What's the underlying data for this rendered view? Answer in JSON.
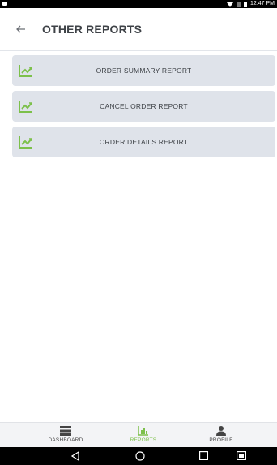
{
  "status_bar": {
    "time": "12:47 PM"
  },
  "app_bar": {
    "title": "OTHER REPORTS",
    "back_icon": "arrow-left-icon"
  },
  "reports": [
    {
      "label": "ORDER SUMMARY REPORT",
      "icon": "trend-chart-icon"
    },
    {
      "label": "CANCEL ORDER REPORT",
      "icon": "trend-chart-icon"
    },
    {
      "label": "ORDER DETAILS REPORT",
      "icon": "trend-chart-icon"
    }
  ],
  "bottom_nav": {
    "items": [
      {
        "label": "DASHBOARD",
        "icon": "dashboard-icon",
        "active": false
      },
      {
        "label": "REPORTS",
        "icon": "reports-icon",
        "active": true
      },
      {
        "label": "PROFILE",
        "icon": "profile-icon",
        "active": false
      }
    ]
  },
  "colors": {
    "accent": "#7cc04a",
    "card_bg": "#dfe3ea",
    "text": "#3e4247"
  }
}
